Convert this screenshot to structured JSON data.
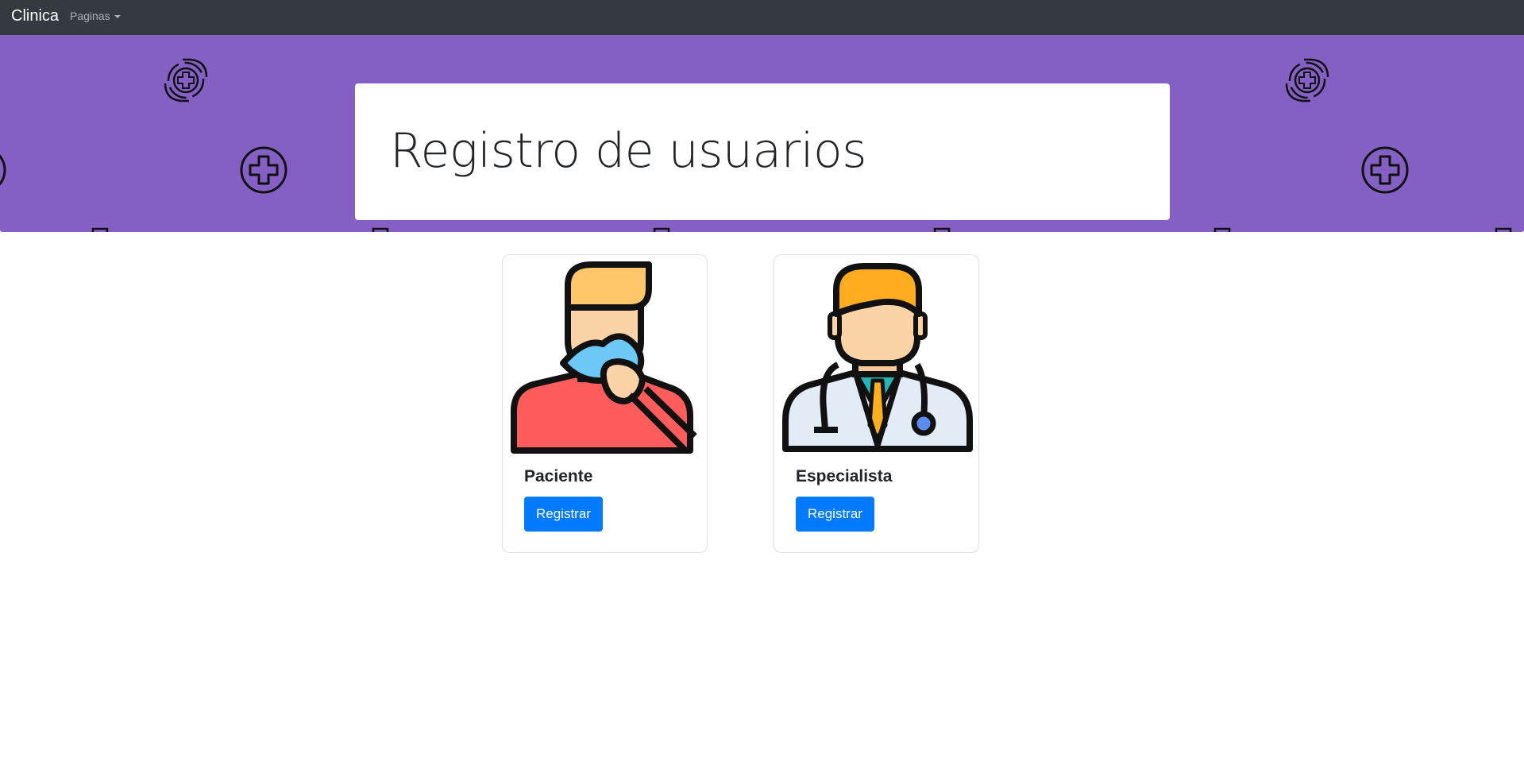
{
  "navbar": {
    "brand": "Clinica",
    "dropdown_label": "Paginas"
  },
  "banner": {
    "background_color": "#8560c4",
    "pattern_icons": [
      "medical-cross-circle-icon",
      "caring-hands-medical-icon"
    ]
  },
  "jumbotron": {
    "title": "Registro de usuarios"
  },
  "cards": [
    {
      "title": "Paciente",
      "button_label": "Registrar",
      "image_icon": "sick-patient-illustration"
    },
    {
      "title": "Especialista",
      "button_label": "Registrar",
      "image_icon": "doctor-illustration"
    }
  ],
  "colors": {
    "navbar": "#343a40",
    "primary": "#007bff"
  }
}
